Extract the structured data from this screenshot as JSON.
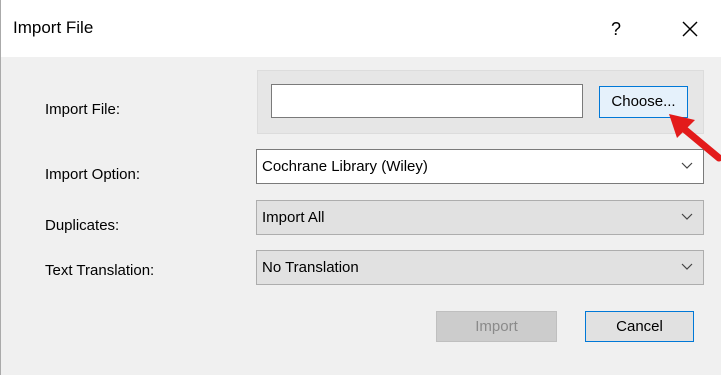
{
  "window": {
    "title": "Import File",
    "help_label": "?"
  },
  "import_file": {
    "label": "Import File:",
    "value": "",
    "choose_label": "Choose..."
  },
  "import_option": {
    "label": "Import Option:",
    "selected": "Cochrane Library (Wiley)"
  },
  "duplicates": {
    "label": "Duplicates:",
    "selected": "Import All"
  },
  "text_translation": {
    "label": "Text Translation:",
    "selected": "No Translation"
  },
  "buttons": {
    "import_label": "Import",
    "cancel_label": "Cancel"
  },
  "icons": {
    "close": "close-icon",
    "chevron": "chevron-down-icon",
    "pointer": "red-arrow-icon"
  },
  "colors": {
    "accent": "#0078d7",
    "arrow": "#e31b1b"
  }
}
